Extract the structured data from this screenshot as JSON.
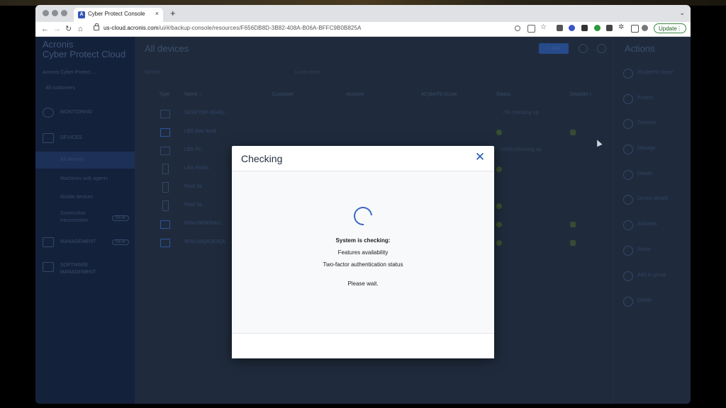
{
  "browser": {
    "tab_title": "Cyber Protect Console",
    "tab_close": "×",
    "new_tab": "+",
    "url_domain": "us-cloud.acronis.com",
    "url_path": "/ui/#/backup-console/resources/F656DB8D-3B82-408A-B06A-BFFC9B0B825A",
    "update_label": "Update",
    "update_more": "⋮",
    "back": "←",
    "forward": "→",
    "reload": "↻",
    "home": "⌂"
  },
  "sidebar": {
    "brand_line1": "Acronis",
    "brand_line2": "Cyber Protect Cloud",
    "tenant": "Acronis Cyber Protect ...",
    "customer_filter": "All customers",
    "monitoring": "MONITORING",
    "devices": "DEVICES",
    "sub_all_devices": "All devices",
    "sub_machines_agents": "Machines with agents",
    "sub_mobile_devices": "Mobile devices",
    "sub_screenshot": "Screenshot transmission",
    "management": "MANAGEMENT",
    "software_management": "SOFTWARE MANAGEMENT",
    "new_badge": "NEW"
  },
  "main": {
    "title": "All devices",
    "add_label": "+ Add",
    "search_label": "Search",
    "group_label": "Load views",
    "columns": {
      "type": "Type",
      "name": "Name ↑",
      "customer": "Customer",
      "account": "Account",
      "cyberfit": "#CyberFit Score",
      "status": "Status",
      "disaster": "Disaster r"
    },
    "rows": [
      {
        "name": "DESKTOP-6GHG...",
        "status": "0% checking up"
      },
      {
        "name": "LBS Mac local",
        "status": ""
      },
      {
        "name": "LBS PC",
        "status": "100% checking up"
      },
      {
        "name": "LBS PIXEL",
        "status": ""
      },
      {
        "name": "Pixel 3a",
        "status": ""
      },
      {
        "name": "Pixel 3a",
        "status": ""
      },
      {
        "name": "WIN-OR5K5H6J...",
        "status": ""
      },
      {
        "name": "WIN-LMQA2E3Q6...",
        "status": ""
      }
    ]
  },
  "actions": {
    "title": "Actions",
    "items": [
      "#CyberFit Score",
      "Protect",
      "Connect",
      "Manage",
      "Details",
      "Device details",
      "Activities",
      "Alerts",
      "Add to group",
      "Delete"
    ]
  },
  "dialog": {
    "title": "Checking",
    "close": "✕",
    "heading": "System is checking:",
    "item1": "Features availability",
    "item2": "Two-factor authentication status",
    "wait": "Please wait."
  }
}
